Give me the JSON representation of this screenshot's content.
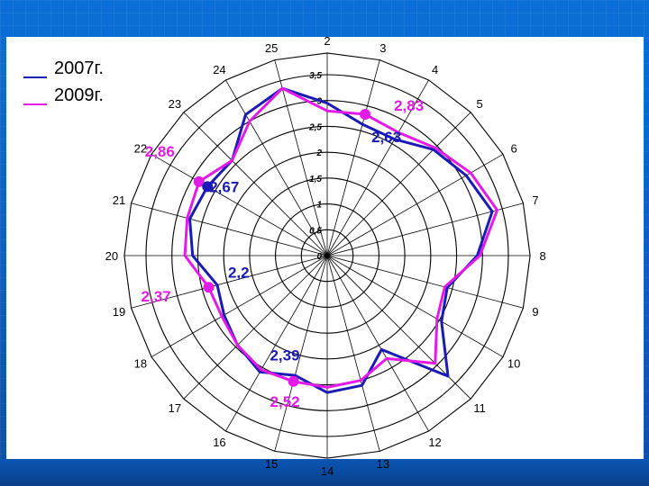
{
  "chart_data": {
    "type": "radar",
    "categories": [
      "2",
      "3",
      "4",
      "5",
      "6",
      "7",
      "8",
      "9",
      "10",
      "11",
      "12",
      "13",
      "14",
      "15",
      "16",
      "17",
      "18",
      "19",
      "20",
      "21",
      "22",
      "23",
      "24",
      "25"
    ],
    "scale_ticks": [
      "0",
      "0,5",
      "1",
      "1,5",
      "2",
      "2,5",
      "3",
      "3,5"
    ],
    "rmax": 3.5,
    "series": [
      {
        "name": "2007г.",
        "color": "#1a1ab4",
        "values": [
          2.95,
          2.63,
          2.6,
          2.9,
          3.1,
          3.3,
          2.9,
          2.4,
          2.55,
          3.3,
          2.1,
          2.6,
          2.65,
          2.4,
          2.6,
          2.45,
          2.3,
          2.2,
          2.6,
          2.75,
          2.67,
          2.6,
          3.15,
          3.35
        ]
      },
      {
        "name": "2009г.",
        "color": "#e31be8",
        "values": [
          2.8,
          2.83,
          2.75,
          2.95,
          3.2,
          3.4,
          2.95,
          2.35,
          2.45,
          2.95,
          2.3,
          2.5,
          2.55,
          2.52,
          2.55,
          2.45,
          2.35,
          2.37,
          2.75,
          2.8,
          2.86,
          2.6,
          3.0,
          3.35
        ]
      }
    ],
    "annotations": [
      {
        "text": "2,83",
        "series": 1,
        "category": "3",
        "value": 2.83
      },
      {
        "text": "2,63",
        "series": 0,
        "category": "3",
        "value": 2.63
      },
      {
        "text": "2,86",
        "series": 1,
        "category": "22",
        "value": 2.86
      },
      {
        "text": "2,67",
        "series": 0,
        "category": "22",
        "value": 2.67
      },
      {
        "text": "2,2",
        "series": 0,
        "category": "19",
        "value": 2.2
      },
      {
        "text": "2,37",
        "series": 1,
        "category": "19",
        "value": 2.37
      },
      {
        "text": "2,39",
        "series": 0,
        "category": "15",
        "value": 2.39
      },
      {
        "text": "2,52",
        "series": 1,
        "category": "15",
        "value": 2.52
      }
    ],
    "grid": true,
    "legend_position": "top-left"
  }
}
